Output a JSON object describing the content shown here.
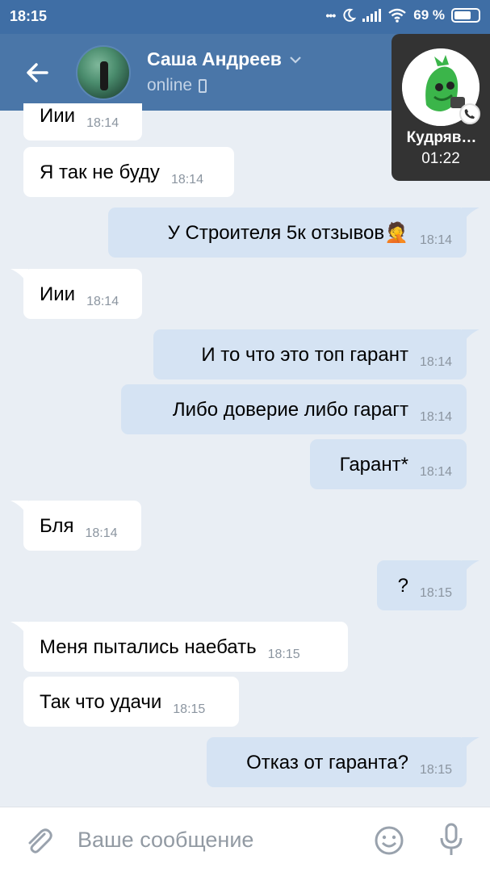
{
  "statusbar": {
    "time": "18:15",
    "dots": "•••",
    "battery": "69 %"
  },
  "header": {
    "name": "Саша Андреев",
    "status": "online"
  },
  "call": {
    "name": "Кудряв…",
    "duration": "01:22"
  },
  "messages": [
    {
      "text": "Иии",
      "time": "18:14",
      "dir": "in"
    },
    {
      "text": "Я так не буду",
      "time": "18:14",
      "dir": "in"
    },
    {
      "text": "У Строителя 5к отзывов🤦",
      "time": "18:14",
      "dir": "out"
    },
    {
      "text": "Иии",
      "time": "18:14",
      "dir": "in"
    },
    {
      "text": "И то что это топ гарант",
      "time": "18:14",
      "dir": "out"
    },
    {
      "text": "Либо доверие либо гарагт",
      "time": "18:14",
      "dir": "out"
    },
    {
      "text": "Гарант*",
      "time": "18:14",
      "dir": "out"
    },
    {
      "text": "Бля",
      "time": "18:14",
      "dir": "in"
    },
    {
      "text": "?",
      "time": "18:15",
      "dir": "out"
    },
    {
      "text": "Меня пытались наебать",
      "time": "18:15",
      "dir": "in"
    },
    {
      "text": "Так что удачи",
      "time": "18:15",
      "dir": "in"
    },
    {
      "text": "Отказ от гаранта?",
      "time": "18:15",
      "dir": "out"
    }
  ],
  "composer": {
    "placeholder": "Ваше сообщение"
  },
  "icons": {
    "back": "arrow-left-icon",
    "chevron": "chevron-down-icon",
    "phone": "phone-icon",
    "attach": "paperclip-icon",
    "emoji": "smiley-icon",
    "mic": "microphone-icon"
  },
  "colors": {
    "header": "#4a76a8",
    "outgoing": "#d5e3f3",
    "incoming": "#ffffff",
    "background": "#e9eef4"
  }
}
